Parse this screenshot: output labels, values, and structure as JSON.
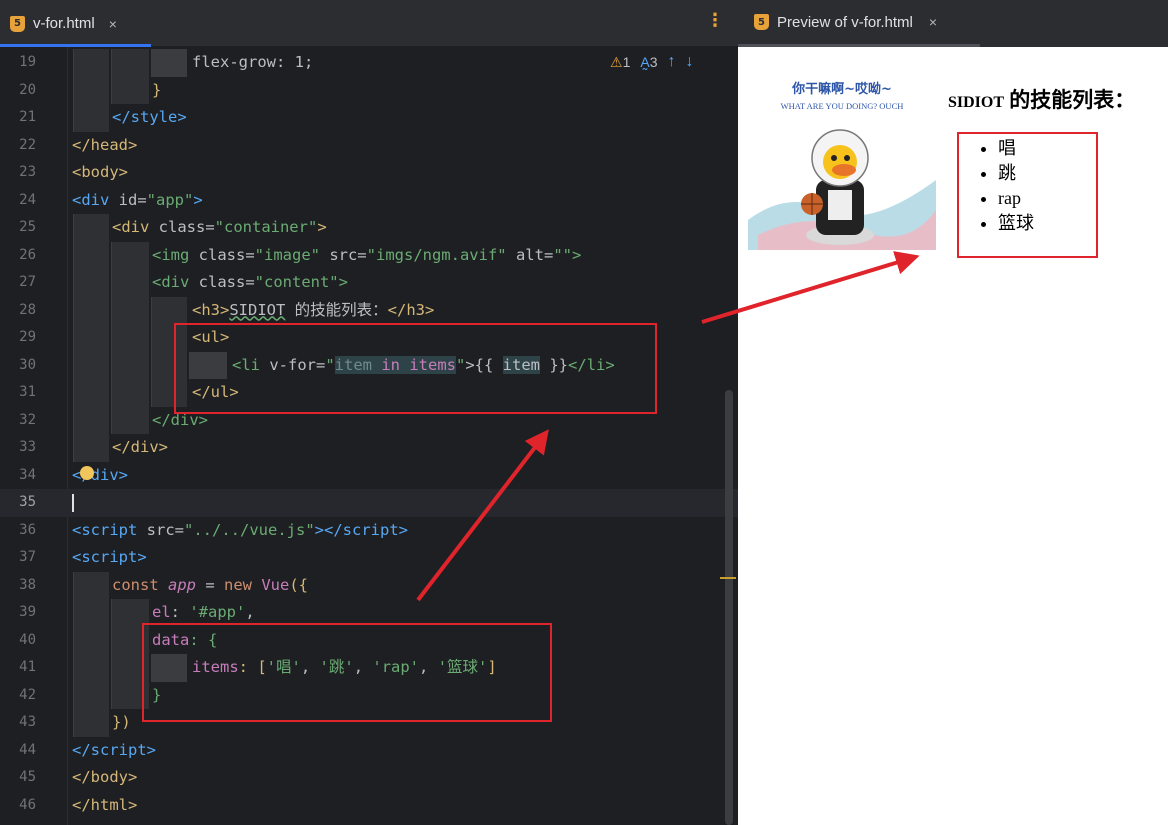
{
  "editor": {
    "tab": {
      "label": "v-for.html",
      "close": "×",
      "icon_text": "5"
    },
    "menu_icon": "more-vertical-icon",
    "inspections": {
      "warnings": "1",
      "typos": "3"
    },
    "lines": [
      {
        "n": "19"
      },
      {
        "n": "20"
      },
      {
        "n": "21"
      },
      {
        "n": "22"
      },
      {
        "n": "23"
      },
      {
        "n": "24"
      },
      {
        "n": "25"
      },
      {
        "n": "26"
      },
      {
        "n": "27"
      },
      {
        "n": "28"
      },
      {
        "n": "29"
      },
      {
        "n": "30"
      },
      {
        "n": "31"
      },
      {
        "n": "32"
      },
      {
        "n": "33"
      },
      {
        "n": "34"
      },
      {
        "n": "35"
      },
      {
        "n": "36"
      },
      {
        "n": "37"
      },
      {
        "n": "38"
      },
      {
        "n": "39"
      },
      {
        "n": "40"
      },
      {
        "n": "41"
      },
      {
        "n": "42"
      },
      {
        "n": "43"
      },
      {
        "n": "44"
      },
      {
        "n": "45"
      },
      {
        "n": "46"
      }
    ],
    "code": {
      "l19": "flex-grow: 1;",
      "l20": "}",
      "l21": "</style>",
      "l22": "</head>",
      "l23": "<body>",
      "l24a": "<div",
      "l24b": " id=",
      "l24c": "\"app\"",
      "l24d": ">",
      "l25a": "<div",
      "l25b": " class=",
      "l25c": "\"container\"",
      "l25d": ">",
      "l26a": "<img",
      "l26b": " class=",
      "l26c": "\"image\"",
      "l26d": " src=",
      "l26e": "\"imgs/ngm.avif\"",
      "l26f": " alt=",
      "l26g": "\"\"",
      "l26h": ">",
      "l27a": "<div",
      "l27b": " class=",
      "l27c": "\"content\"",
      "l27d": ">",
      "l28a": "<h3>",
      "l28b": "SIDIOT",
      "l28c": " 的技能列表：",
      "l28d": "</h3>",
      "l29": "<ul>",
      "l30a": "<li",
      "l30b": " v-for=",
      "l30c": "\"",
      "l30d": "item",
      "l30e": " in ",
      "l30f": "items",
      "l30g": "\"",
      "l30h": ">{{ ",
      "l30i": "item",
      "l30j": " }}",
      "l30k": "</li>",
      "l31": "</ul>",
      "l32": "</div>",
      "l33": "</div>",
      "l34": "</div>",
      "l36a": "<script",
      "l36b": " src=",
      "l36c": "\"../../vue.js\"",
      "l36d": "></scr",
      "l36e": "ipt>",
      "l37": "<script>",
      "l38a": "const ",
      "l38b": "app",
      "l38c": " = ",
      "l38d": "new ",
      "l38e": "Vue",
      "l38f": "({",
      "l39a": "el",
      "l39b": ": ",
      "l39c": "'#app'",
      "l39d": ",",
      "l40a": "data",
      "l40b": ": {",
      "l41a": "items",
      "l41b": ": [",
      "l41c": "'唱'",
      "l41d": ", ",
      "l41e": "'跳'",
      "l41f": ", ",
      "l41g": "'rap'",
      "l41h": ", ",
      "l41i": "'篮球'",
      "l41j": "]",
      "l42": "}",
      "l43": "})",
      "l44a": "</scr",
      "l44b": "ipt>",
      "l45": "</body>",
      "l46": "</html>"
    }
  },
  "preview": {
    "tab": {
      "label": "Preview of v-for.html",
      "close": "×",
      "icon_text": "5"
    },
    "image": {
      "caption_cn": "你干嘛啊~哎呦~",
      "caption_en": "WHAT ARE YOU DOING? OUCH"
    },
    "heading_name": "SIDIOT",
    "heading_rest": " 的技能列表：",
    "items": [
      "唱",
      "跳",
      "rap",
      "篮球"
    ]
  },
  "annotations": {
    "box_color": "#e0242b",
    "arrow_color": "#e0242b"
  }
}
